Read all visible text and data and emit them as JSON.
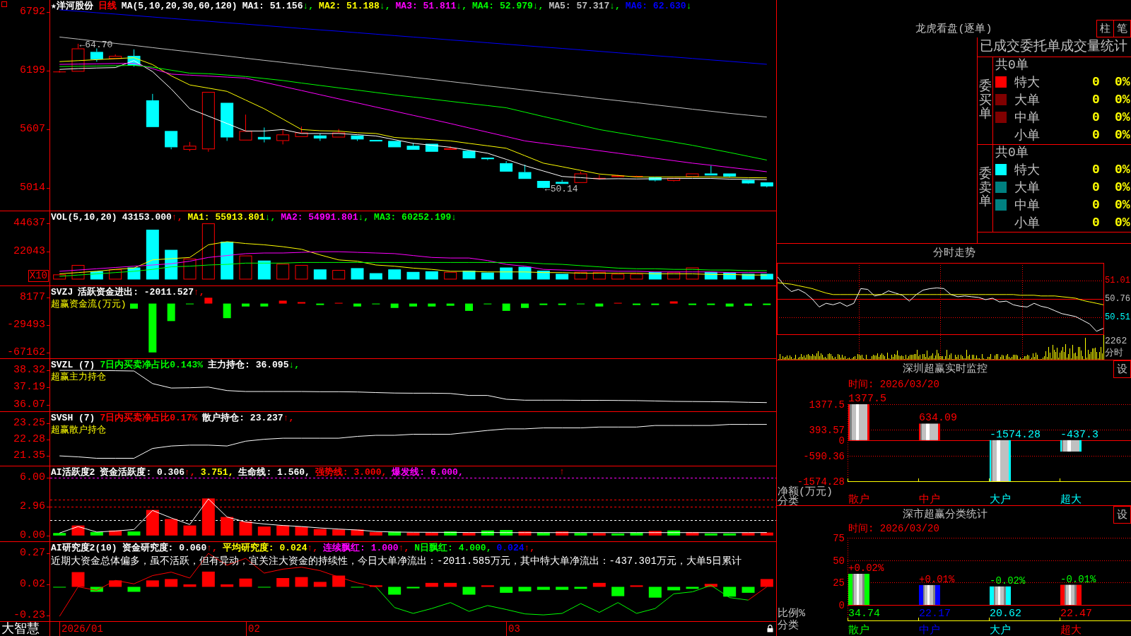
{
  "panels": [
    {
      "kind": "candles",
      "legend": [
        {
          "text": "★洋河股份"
        },
        {
          "text": "日线",
          "color": "#ff0000"
        },
        {
          "text": "MA(5,10,20,30,60,120)"
        },
        {
          "text": "MA1: 51.156",
          "arrow": "↓,",
          "rising": false
        },
        {
          "text": "MA2: 51.188",
          "color": "#ffff00",
          "arrow": "↓,",
          "rising": false
        },
        {
          "text": "MA3: 51.811",
          "color": "#ff00ff",
          "arrow": "↓,",
          "rising": false
        },
        {
          "text": "MA4: 52.979",
          "color": "#00ff00",
          "arrow": "↓,",
          "rising": false
        },
        {
          "text": "MA5: 57.317",
          "color": "#c0c0c0",
          "arrow": "↓,",
          "rising": false
        },
        {
          "text": "MA6: 62.630",
          "color": "#0000ff",
          "arrow": "↓",
          "rising": false
        }
      ],
      "chart_data": {
        "type": "candlestick",
        "ylim": [
          4789,
          6911
        ],
        "yticks": [
          5014,
          5607,
          6199,
          6792
        ],
        "ohlc": [
          [
            6190,
            6200,
            6180,
            6190
          ],
          [
            6189,
            6470,
            6189,
            6423
          ],
          [
            6388,
            6423,
            6289,
            6314
          ],
          [
            6318,
            6363,
            6318,
            6348
          ],
          [
            6348,
            6413,
            6239,
            6249
          ],
          [
            5900,
            5965,
            5631,
            5631
          ],
          [
            5591,
            5591,
            5407,
            5427
          ],
          [
            5402,
            5481,
            5387,
            5442
          ],
          [
            5407,
            5985,
            5382,
            5985
          ],
          [
            5875,
            5875,
            5491,
            5526
          ],
          [
            5496,
            5756,
            5496,
            5591
          ],
          [
            5531,
            5626,
            5476,
            5506
          ],
          [
            5491,
            5606,
            5456,
            5556
          ],
          [
            5531,
            5636,
            5531,
            5576
          ],
          [
            5546,
            5566,
            5491,
            5516
          ],
          [
            5526,
            5611,
            5526,
            5576
          ],
          [
            5546,
            5546,
            5491,
            5506
          ],
          [
            5501,
            5501,
            5486,
            5486
          ],
          [
            5491,
            5491,
            5427,
            5427
          ],
          [
            5442,
            5471,
            5402,
            5402
          ],
          [
            5462,
            5462,
            5382,
            5382
          ],
          [
            5402,
            5437,
            5402,
            5417
          ],
          [
            5392,
            5392,
            5317,
            5317
          ],
          [
            5322,
            5322,
            5297,
            5307
          ],
          [
            5267,
            5287,
            5182,
            5182
          ],
          [
            5177,
            5252,
            5108,
            5108
          ],
          [
            5088,
            5088,
            5014,
            5018
          ],
          [
            5078,
            5098,
            5058,
            5058
          ],
          [
            5068,
            5182,
            5068,
            5163
          ],
          [
            5108,
            5148,
            5100,
            5118
          ],
          [
            5128,
            5150,
            5125,
            5143
          ],
          [
            5133,
            5140,
            5128,
            5138
          ],
          [
            5123,
            5123,
            5083,
            5093
          ],
          [
            5088,
            5118,
            5083,
            5118
          ],
          [
            5128,
            5163,
            5128,
            5163
          ],
          [
            5163,
            5242,
            5143,
            5143
          ],
          [
            5163,
            5163,
            5123,
            5133
          ],
          [
            5098,
            5098,
            5058,
            5063
          ],
          [
            5073,
            5073,
            5023,
            5033
          ]
        ],
        "series": [
          {
            "type": "line",
            "color": "#ffffff",
            "values": [
              6212,
              6220,
              6226,
              6230,
              6300,
              6190,
              6015,
              5815,
              5741,
              5666,
              5591,
              5591,
              5606,
              5566,
              5566,
              5566,
              5554,
              5541,
              5504,
              5467,
              5447,
              5427,
              5397,
              5367,
              5305,
              5242,
              5188,
              5133,
              5121,
              5108,
              5110,
              5108,
              5110,
              5112,
              5113,
              5113,
              5106,
              5104,
              5100
            ]
          },
          {
            "type": "line",
            "color": "#ffff00",
            "values": [
              6290,
              6300,
              6310,
              6320,
              6330,
              6260,
              6147,
              6055,
              6023,
              5990,
              5903,
              5815,
              5711,
              5606,
              5594,
              5590,
              5574,
              5566,
              5526,
              5514,
              5503,
              5491,
              5466,
              5442,
              5417,
              5342,
              5267,
              5231,
              5194,
              5158,
              5143,
              5128,
              5128,
              5128,
              5128,
              5128,
              5124,
              5121,
              5119
            ]
          },
          {
            "type": "line",
            "color": "#ff00ff",
            "values": [
              6262,
              6265,
              6268,
              6271,
              6274,
              6219,
              6164,
              6154,
              6144,
              6134,
              6124,
              6082,
              6040,
              5999,
              5957,
              5915,
              5874,
              5832,
              5791,
              5749,
              5708,
              5666,
              5622,
              5579,
              5535,
              5491,
              5466,
              5442,
              5417,
              5392,
              5367,
              5342,
              5317,
              5292,
              5267,
              5246,
              5224,
              5203,
              5181
            ]
          },
          {
            "type": "line",
            "color": "#00ff00",
            "values": [
              6240,
              6243,
              6246,
              6249,
              6252,
              6234,
              6204,
              6174,
              6168,
              6155,
              6140,
              6120,
              6100,
              6074,
              6050,
              6026,
              6003,
              5979,
              5955,
              5933,
              5912,
              5890,
              5868,
              5847,
              5825,
              5781,
              5737,
              5694,
              5650,
              5606,
              5574,
              5542,
              5511,
              5479,
              5447,
              5411,
              5374,
              5336,
              5298
            ]
          },
          {
            "type": "line",
            "color": "#c0c0c0",
            "values": [
              6538,
              6517,
              6495,
              6474,
              6453,
              6431,
              6410,
              6388,
              6367,
              6346,
              6324,
              6303,
              6282,
              6260,
              6239,
              6217,
              6196,
              6175,
              6153,
              6132,
              6111,
              6089,
              6068,
              6046,
              6025,
              6004,
              5982,
              5961,
              5940,
              5918,
              5897,
              5876,
              5854,
              5833,
              5811,
              5790,
              5769,
              5750,
              5732
            ]
          },
          {
            "type": "line",
            "color": "#0000ff",
            "values": [
              6812,
              6798,
              6783,
              6769,
              6754,
              6740,
              6725,
              6711,
              6697,
              6682,
              6668,
              6653,
              6639,
              6624,
              6610,
              6596,
              6581,
              6567,
              6552,
              6538,
              6524,
              6509,
              6495,
              6480,
              6466,
              6451,
              6437,
              6423,
              6408,
              6394,
              6379,
              6365,
              6350,
              6336,
              6322,
              6307,
              6293,
              6278,
              6263
            ]
          }
        ],
        "annotations": [
          "←64.70",
          "←50.14"
        ]
      }
    },
    {
      "kind": "volume",
      "legend": [
        {
          "text": "VOL(5,10,20)"
        },
        {
          "text": "43153.000",
          "arrow": "↑,",
          "rising": true
        },
        {
          "text": "MA1: 55913.801",
          "color": "#ffff00",
          "arrow": "↓,",
          "rising": false
        },
        {
          "text": "MA2: 54991.801",
          "color": "#ff00ff",
          "arrow": "↓,",
          "rising": false
        },
        {
          "text": "MA3: 60252.199",
          "color": "#00ff00",
          "arrow": "↓",
          "rising": false
        }
      ],
      "unit_badge": "X10",
      "chart_data": {
        "type": "bar",
        "ylim": [
          -4775,
          54075
        ],
        "yticks": [
          22043,
          44637
        ],
        "series": [
          {
            "type": "bar",
            "colors": [
              "#ff0000",
              "#ff0000",
              "#00ffff",
              "#ff0000",
              "#00ffff",
              "#00ffff",
              "#00ffff",
              "#ff0000",
              "#ff0000",
              "#00ffff",
              "#ff0000",
              "#00ffff",
              "#ff0000",
              "#ff0000",
              "#00ffff",
              "#ff0000",
              "#00ffff",
              "#00ffff",
              "#00ffff",
              "#00ffff",
              "#00ffff",
              "#ff0000",
              "#00ffff",
              "#00ffff",
              "#00ffff",
              "#00ffff",
              "#00ffff",
              "#00ffff",
              "#ff0000",
              "#ff0000",
              "#ff0000",
              "#ff0000",
              "#00ffff",
              "#ff0000",
              "#ff0000",
              "#00ffff",
              "#00ffff",
              "#00ffff",
              "#00ffff"
            ],
            "values": [
              4000,
              11500,
              6500,
              8000,
              9500,
              39500,
              23500,
              16500,
              44500,
              30000,
              19000,
              15000,
              12500,
              11500,
              8000,
              7500,
              9000,
              5000,
              8000,
              6000,
              6500,
              6000,
              7000,
              5500,
              9500,
              10000,
              7000,
              4500,
              6000,
              6000,
              4500,
              4500,
              6000,
              6000,
              9500,
              6000,
              5500,
              4500,
              4500
            ]
          },
          {
            "type": "line",
            "color": "#ffff00",
            "values": [
              4500,
              5500,
              6500,
              8000,
              9000,
              15500,
              16500,
              17500,
              27500,
              30000,
              28500,
              27500,
              26000,
              24000,
              19500,
              15500,
              14500,
              11500,
              10500,
              9000,
              8000,
              6500,
              6500,
              6000,
              6000,
              6000,
              5500,
              5500,
              5000,
              5000,
              5000,
              5000,
              4500,
              4500,
              4500,
              4000,
              4000,
              3500,
              3500
            ]
          },
          {
            "type": "line",
            "color": "#ff00ff",
            "values": [
              6500,
              7500,
              8500,
              9500,
              10500,
              11500,
              12500,
              14500,
              17500,
              19000,
              20500,
              21000,
              21000,
              21500,
              22000,
              22000,
              21500,
              21000,
              20500,
              19000,
              17500,
              17000,
              17000,
              15000,
              12000,
              10500,
              8000,
              7500,
              7000,
              7000,
              6500,
              6500,
              6000,
              6000,
              6000,
              6000,
              5500,
              5500,
              5500
            ]
          },
          {
            "type": "line",
            "color": "#00ff00",
            "values": [
              2500,
              3500,
              4500,
              5500,
              6500,
              8000,
              10000,
              10500,
              11500,
              12000,
              13000,
              13000,
              13000,
              13500,
              13500,
              13500,
              13500,
              13500,
              13500,
              13500,
              13500,
              13500,
              13500,
              13500,
              13500,
              13500,
              12500,
              12000,
              11000,
              10000,
              9000,
              8500,
              8500,
              8000,
              8000,
              7500,
              7500,
              7000,
              7000
            ]
          }
        ]
      }
    },
    {
      "kind": "flow",
      "legend": [
        {
          "text": "SVZJ"
        },
        {
          "text": "活跃资金进出: -2011.527",
          "arrow": "↑,",
          "rising": true
        }
      ],
      "subtitle": "超赢资金流(万元)",
      "chart_data": {
        "type": "bar",
        "ylim": [
          -75032,
          23820
        ],
        "yticks": [
          -67162,
          -29493,
          8177
        ],
        "series": [
          {
            "type": "bar",
            "color": "#ff0000",
            "values": [
              null,
              null,
              null,
              null,
              null,
              null,
              null,
              null,
              8000,
              null,
              null,
              null,
              4000,
              2000,
              null,
              1000,
              null,
              null,
              null,
              null,
              null,
              null,
              null,
              null,
              null,
              null,
              null,
              null,
              null,
              null,
              1000,
              null,
              null,
              3000,
              null,
              null,
              null,
              null,
              null
            ]
          },
          {
            "type": "bar",
            "color": "#00ff00",
            "values": [
              null,
              null,
              null,
              null,
              -7000,
              -67000,
              -24000,
              -1000,
              null,
              -20000,
              -4000,
              -4000,
              null,
              null,
              -2000,
              null,
              -4000,
              -1000,
              -6000,
              -4000,
              -4000,
              -3000,
              -10000,
              -1000,
              -10000,
              -6000,
              -2000,
              -2000,
              -1000,
              -4000,
              null,
              -2000,
              -2000,
              null,
              -2000,
              -2000,
              -4000,
              -3000,
              -2000
            ]
          }
        ]
      }
    },
    {
      "kind": "holding",
      "legend": [
        {
          "text": "SVZL (7)"
        },
        {
          "text": "7日内买卖净占比0.143%",
          "color": "#00ff00"
        },
        {
          "text": "主力持仓: 36.095",
          "arrow": "↓,",
          "rising": false
        }
      ],
      "subtitle": "超赢主力持仓",
      "chart_data": {
        "type": "line",
        "ylim": [
          35.63,
          39.07
        ],
        "yticks": [
          36.07,
          37.19,
          38.32
        ],
        "series": [
          {
            "type": "line",
            "color": "#ffffff",
            "values": [
              38.32,
              38.32,
              38.31,
              38.3,
              38.28,
              37.45,
              37.16,
              37.18,
              37.22,
              36.99,
              36.93,
              36.93,
              36.93,
              36.93,
              36.92,
              36.92,
              36.9,
              36.86,
              36.83,
              36.82,
              36.82,
              36.8,
              36.67,
              36.67,
              36.42,
              36.36,
              36.36,
              36.36,
              36.35,
              36.35,
              36.34,
              36.33,
              36.31,
              36.28,
              36.27,
              36.26,
              36.25,
              36.22,
              36.2
            ]
          }
        ]
      }
    },
    {
      "kind": "holding",
      "legend": [
        {
          "text": "SVSH (7)"
        },
        {
          "text": "7日内买卖净占比0.17%",
          "color": "#ff0000"
        },
        {
          "text": "散户持仓: 23.237",
          "arrow": "↑,",
          "rising": true
        }
      ],
      "subtitle": "超赢散户持仓",
      "chart_data": {
        "type": "line",
        "ylim": [
          20.78,
          23.89
        ],
        "yticks": [
          21.35,
          22.28,
          23.25
        ],
        "series": [
          {
            "type": "line",
            "color": "#ffffff",
            "values": [
              21.35,
              21.29,
              21.21,
              21.21,
              21.21,
              21.78,
              21.92,
              21.97,
              21.97,
              21.92,
              22.2,
              22.31,
              22.37,
              22.37,
              22.37,
              22.37,
              22.48,
              22.54,
              22.54,
              22.6,
              22.6,
              22.6,
              22.71,
              22.82,
              22.91,
              22.91,
              22.97,
              22.97,
              22.97,
              23.02,
              23.02,
              23.02,
              23.11,
              23.11,
              23.11,
              23.11,
              23.17,
              23.17,
              23.17
            ]
          }
        ]
      }
    },
    {
      "kind": "activity",
      "legend": [
        {
          "text": "AI活跃度2"
        },
        {
          "text": "资金活跃度: 0.306",
          "arrow": "↑,",
          "rising": true
        },
        {
          "text": "3.751,",
          "color": "#ffff00"
        },
        {
          "text": "生命线: 1.560,"
        },
        {
          "text": "强势线: 3.000,",
          "color": "#ff0000"
        },
        {
          "text": "爆发线: 6.000,",
          "color": "#ff00ff"
        }
      ],
      "signal": "↑",
      "chart_data": {
        "type": "bar",
        "ylim": [
          -0.6,
          7.16
        ],
        "yticks": [
          {
            "value": 0,
            "label": "0.00"
          },
          {
            "value": 2.96,
            "label": "2.96"
          },
          {
            "value": 6,
            "label": "6.00"
          }
        ],
        "ref_lines": [
          {
            "axis": "y",
            "value": 6,
            "color": "#ff00ff",
            "line_style": "dashed"
          },
          {
            "axis": "y",
            "value": 3.751,
            "color": "#ff0000",
            "line_style": "dashed"
          },
          {
            "axis": "y",
            "value": 3,
            "color": "#ff0000",
            "line_style": "dashed"
          },
          {
            "axis": "y",
            "value": 1.56,
            "color": "#ffffff",
            "line_style": "dashed"
          }
        ],
        "series": [
          {
            "type": "bar",
            "colors": [
              "#00ff00",
              "#ff0000",
              "#00ff00",
              "#ff0000",
              "#00ff00",
              "#ff0000",
              "#ff0000",
              "#ff0000",
              "#ff0000",
              "#ff0000",
              "#ff0000",
              "#ff0000",
              "#ff0000",
              "#ff0000",
              "#ff0000",
              "#ff0000",
              "#ff0000",
              "#ff0000",
              "#00ff00",
              "#ff0000",
              "#ff0000",
              "#00ff00",
              "#ff0000",
              "#00ff00",
              "#00ff00",
              "#ff0000",
              "#00ff00",
              "#ff0000",
              "#00ff00",
              "#ff0000",
              "#00ff00",
              "#00ff00",
              "#ff0000",
              "#00ff00",
              "#ff0000",
              "#00ff00",
              "#00ff00",
              "#ff0000",
              "#ff0000"
            ],
            "values": [
              0.26,
              1.04,
              0.36,
              0.52,
              0.42,
              2.65,
              1.71,
              1.04,
              3.84,
              1.92,
              1.45,
              0.93,
              1.04,
              0.93,
              0.67,
              0.62,
              0.62,
              0.36,
              0.42,
              0.31,
              0.31,
              0.42,
              0.31,
              0.52,
              0.57,
              0.42,
              0.31,
              0.42,
              0.26,
              0.26,
              0.21,
              0.31,
              0.47,
              0.52,
              0.36,
              0.21,
              0.21,
              0.31,
              0.31
            ]
          },
          {
            "type": "line",
            "color": "#ffffff",
            "values": [
              0.26,
              0.93,
              0.36,
              0.47,
              0.62,
              2.6,
              1.82,
              1.14,
              3.79,
              1.92,
              1.4,
              1.19,
              1.04,
              0.93,
              0.78,
              0.67,
              0.57,
              0.42,
              0.36,
              0.34,
              0.33,
              0.32,
              0.31,
              0.31,
              0.3,
              0.3,
              0.3,
              0.3,
              0.3,
              0.3,
              0.3,
              0.3,
              0.3,
              0.3,
              0.3,
              0.3,
              0.3,
              0.3,
              0.31
            ]
          }
        ]
      }
    },
    {
      "kind": "research",
      "legend": [
        {
          "text": "AI研究度2(10)"
        },
        {
          "text": "资金研究度: 0.060",
          "arrow": "↑,",
          "rising": true
        },
        {
          "text": "平均研究度: 0.024",
          "color": "#ffff00",
          "arrow": "↑,",
          "rising": true
        },
        {
          "text": "连续飘红: 1.000",
          "color": "#ff00ff",
          "arrow": "↑,",
          "rising": true
        },
        {
          "text": "N日飘红: 4.000,",
          "color": "#00ff00"
        },
        {
          "text": "0.024",
          "color": "#0000ff",
          "arrow": "↑,",
          "rising": true
        }
      ],
      "commentary": "近期大资金总体偏多，虽不活跃，但有异动，宜关注大资金的持续性，今日大单净流出：-2011.585万元，其中特大单净流出：-437.301万元，大单5日累计",
      "chart_data": {
        "type": "bar",
        "ylim": [
          -0.277,
          0.362
        ],
        "yticks": [
          -0.23,
          0.02,
          0.27
        ],
        "series": [
          {
            "type": "bar",
            "colors": [
              "#00ff00",
              "#ff0000",
              "#00ff00",
              "#ff0000",
              "#00ff00",
              "#ff0000",
              "#ff0000",
              "#ff0000",
              "#ff0000",
              "#ff0000",
              "#ff0000",
              "#00ff00",
              "#ff0000",
              "#ff0000",
              "#ff0000",
              "#ff0000",
              "#00ff00",
              "#ff0000",
              "#00ff00",
              "#00ff00",
              "#ff0000",
              "#ff0000",
              "#00ff00",
              "#ff0000",
              "#00ff00",
              "#00ff00",
              "#00ff00",
              "#00ff00",
              "#00ff00",
              "#ff0000",
              "#00ff00",
              "#ff0000",
              "#00ff00",
              "#00ff00",
              "#00ff00",
              "#ff0000",
              "#00ff00",
              "#00ff00",
              "#ff0000"
            ],
            "values": [
              -0.005,
              0.119,
              -0.04,
              0.052,
              -0.04,
              0.052,
              0.063,
              0.02,
              0.123,
              0.02,
              0.067,
              -0.005,
              0.071,
              0.079,
              0.04,
              0.091,
              -0.005,
              0.012,
              -0.063,
              -0.012,
              0.032,
              0.032,
              -0.063,
              0.012,
              -0.048,
              -0.036,
              -0.024,
              -0.024,
              -0.016,
              0.032,
              -0.075,
              0.012,
              -0.087,
              -0.028,
              -0.016,
              0.024,
              -0.079,
              -0.048,
              0.063
            ]
          },
          {
            "type": "line",
            "color": "#ff0000",
            "values": [
              -0.238,
              0,
              -0.028,
              0.052,
              0.024,
              0.091,
              0.119,
              0.071,
              0.27,
              0.175,
              0.23,
              0.111,
              0.143,
              0.159,
              0.131,
              0.079,
              0.032,
              0,
              null,
              null,
              null,
              null,
              null,
              null,
              null,
              null,
              null,
              null,
              null,
              null,
              null,
              null,
              null,
              null,
              null,
              null,
              null,
              -0.107,
              0
            ]
          },
          {
            "type": "line",
            "color": "#00ff00",
            "values": [
              null,
              null,
              null,
              null,
              null,
              null,
              null,
              null,
              null,
              null,
              null,
              null,
              null,
              null,
              null,
              null,
              null,
              0,
              -0.167,
              -0.214,
              -0.175,
              -0.127,
              -0.198,
              -0.151,
              -0.183,
              -0.218,
              -0.226,
              -0.214,
              -0.135,
              -0.206,
              -0.127,
              -0.214,
              -0.175,
              -0.056,
              -0.04,
              0.012,
              -0.087,
              -0.107,
              null
            ]
          }
        ]
      }
    }
  ],
  "time_axis": {
    "brand": "大智慧",
    "labels": [
      "2026/01",
      "02",
      "03"
    ]
  },
  "dragon_tiger": {
    "title": "龙虎看盘(逐单)",
    "buttons": [
      "柱",
      "笔"
    ],
    "table": {
      "title": "已成交委托单成交量统计",
      "groups": [
        {
          "label": "委买单",
          "total": "共0单",
          "rows": [
            {
              "name": "特大",
              "color": "#ff0000",
              "count": "0",
              "share": "0%"
            },
            {
              "name": "大单",
              "color": "#800000",
              "count": "0",
              "share": "0%"
            },
            {
              "name": "中单",
              "color": "#800000",
              "count": "0",
              "share": "0%"
            },
            {
              "name": "小单",
              "count": "0",
              "share": "0%"
            }
          ]
        },
        {
          "label": "委卖单",
          "total": "共0单",
          "rows": [
            {
              "name": "特大",
              "color": "#00ffff",
              "count": "0",
              "share": "0%"
            },
            {
              "name": "大单",
              "color": "#008080",
              "count": "0",
              "share": "0%"
            },
            {
              "name": "中单",
              "color": "#008080",
              "count": "0",
              "share": "0%"
            },
            {
              "name": "小单",
              "count": "0",
              "share": "0%"
            }
          ]
        }
      ]
    }
  },
  "intraday": {
    "title": "分时走势",
    "volume_max": "2262",
    "volume_label": "分时",
    "chart_data": {
      "type": "line",
      "ylim": [
        50.27,
        51.25
      ],
      "yticks": [
        50.51,
        50.76,
        51.01
      ],
      "grid": true,
      "ref_lines": [
        {
          "axis": "y",
          "value": 50.76,
          "color": "#ff0000",
          "line_style": "solid"
        }
      ],
      "series": [
        {
          "color": "#ffffff",
          "values": [
            51.06,
            50.94,
            50.86,
            50.89,
            50.84,
            50.76,
            50.65,
            50.7,
            50.68,
            50.71,
            50.66,
            50.7,
            50.9,
            50.89,
            50.8,
            50.82,
            50.87,
            50.84,
            50.81,
            50.73,
            50.82,
            50.88,
            50.9,
            50.91,
            50.9,
            50.82,
            50.79,
            50.8,
            50.79,
            50.78,
            50.75,
            50.77,
            50.72,
            50.73,
            50.68,
            50.66,
            50.65,
            50.7,
            50.66,
            50.64,
            50.6,
            50.56,
            50.54,
            50.52,
            50.47,
            50.42,
            50.32,
            50.36
          ]
        },
        {
          "color": "#ffff00",
          "values": [
            50.98,
            50.97,
            50.96,
            50.94,
            50.92,
            50.9,
            50.87,
            50.84,
            50.82,
            50.82,
            50.82,
            50.82,
            50.82,
            50.82,
            50.82,
            50.82,
            50.82,
            50.82,
            50.82,
            50.82,
            50.82,
            50.82,
            50.82,
            50.82,
            50.82,
            50.82,
            50.82,
            50.82,
            50.82,
            50.82,
            50.82,
            50.82,
            50.82,
            50.82,
            50.82,
            50.81,
            50.81,
            50.81,
            50.8,
            50.8,
            50.8,
            50.79,
            50.78,
            50.77,
            50.74,
            50.72,
            50.7,
            50.68
          ]
        }
      ]
    }
  },
  "monitor": {
    "title": "深圳超赢实时监控",
    "settings_button": "设",
    "time": "时间: 2026/03/20",
    "chart_data": {
      "type": "bar",
      "categories": [
        "散户",
        "中户",
        "大户",
        "超大"
      ],
      "values": [
        1377.5,
        634.09,
        -1574.28,
        -437.3
      ],
      "colors": [
        "#ff0000",
        "#ff0000",
        "#00ffff",
        "#00ffff"
      ],
      "ylim": [
        -1574.28,
        1377.5
      ],
      "yticks": [
        -1574.28,
        -590.36,
        0,
        393.57,
        1377.5
      ],
      "grid": true,
      "ref_lines": [
        {
          "axis": "y",
          "value": 0,
          "color": "#ff0000",
          "line_style": "solid"
        }
      ],
      "value_labels": [
        "1377.5",
        "634.09",
        "-1574.28",
        "-437.3"
      ],
      "ylabel": "净额(万元)",
      "xlabel": "分类"
    }
  },
  "classification": {
    "title": "深市超赢分类统计",
    "settings_button": "设",
    "time": "时间: 2026/03/20",
    "changes": [
      {
        "text": "+0.02%",
        "color": "#ff0000"
      },
      {
        "text": "+0.01%",
        "color": "#ff0000"
      },
      {
        "text": "-0.02%",
        "color": "#00ff00"
      },
      {
        "text": "-0.01%",
        "color": "#00ff00"
      }
    ],
    "chart_data": {
      "type": "bar",
      "categories": [
        "散户",
        "中户",
        "大户",
        "超大"
      ],
      "values": [
        34.74,
        22.17,
        20.62,
        22.47
      ],
      "colors": [
        "#00ff00",
        "#0000ff",
        "#00ffff",
        "#ff0000"
      ],
      "ylim": [
        0,
        75
      ],
      "yticks": [
        0,
        25,
        50,
        75
      ],
      "grid": true,
      "ref_lines": [
        {
          "axis": "y",
          "value": 0,
          "color": "#ff0000",
          "line_style": "solid"
        }
      ],
      "value_labels": [
        "34.74",
        "22.17",
        "20.62",
        "22.47"
      ],
      "ylabel": "比例%",
      "xlabel": "分类"
    }
  }
}
